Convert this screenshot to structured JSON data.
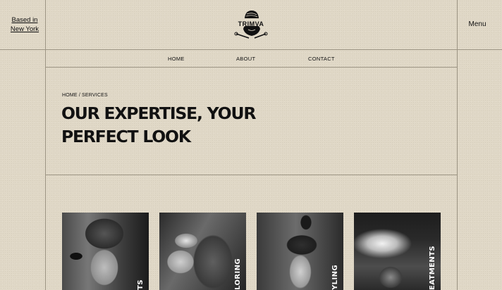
{
  "location": {
    "line1": "Based in",
    "line2": "New York"
  },
  "brand": {
    "name": "TRIMVA"
  },
  "menu_label": "Menu",
  "nav": {
    "items": [
      {
        "label": "HOME"
      },
      {
        "label": "ABOUT"
      },
      {
        "label": "CONTACT"
      }
    ]
  },
  "breadcrumb": {
    "home": "HOME",
    "separator": "/",
    "current": "SERVICES"
  },
  "hero": {
    "line1": "OUR EXPERTISE, YOUR",
    "line2": "PERFECT LOOK"
  },
  "services": [
    {
      "label": "TS",
      "image": "haircut-profile-photo"
    },
    {
      "label": "LORING",
      "image": "hair-coloring-photo"
    },
    {
      "label": "YLING",
      "image": "styling-blow-dry-photo"
    },
    {
      "label": "EATMENTS",
      "image": "treatment-spray-photo"
    }
  ],
  "colors": {
    "background": "#e0d8c7",
    "text": "#111111",
    "rule": "#9c9483"
  }
}
